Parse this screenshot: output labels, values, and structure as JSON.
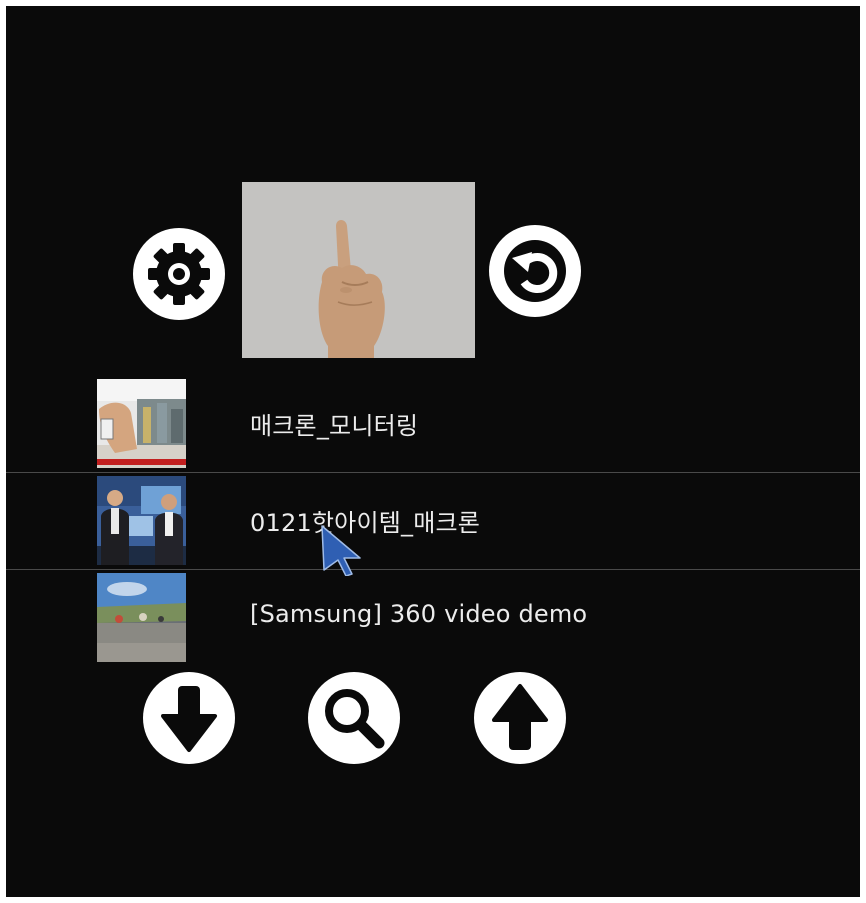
{
  "controls": {
    "settings_icon": "gear-icon",
    "undo_icon": "undo-arrow-icon",
    "scroll_down_icon": "arrow-down-icon",
    "search_icon": "search-icon",
    "scroll_up_icon": "arrow-up-icon"
  },
  "camera_preview": {
    "content": "hand-pointing-up"
  },
  "video_list": {
    "items": [
      {
        "title": "매크론_모니터링"
      },
      {
        "title": "0121핫아이템_매크론"
      },
      {
        "title": "[Samsung] 360 video demo"
      }
    ]
  },
  "colors": {
    "background": "#0a0a0a",
    "button": "#ffffff",
    "text": "#ececec",
    "separator": "#4a4a4a",
    "cursor": "#2f5fb3"
  }
}
